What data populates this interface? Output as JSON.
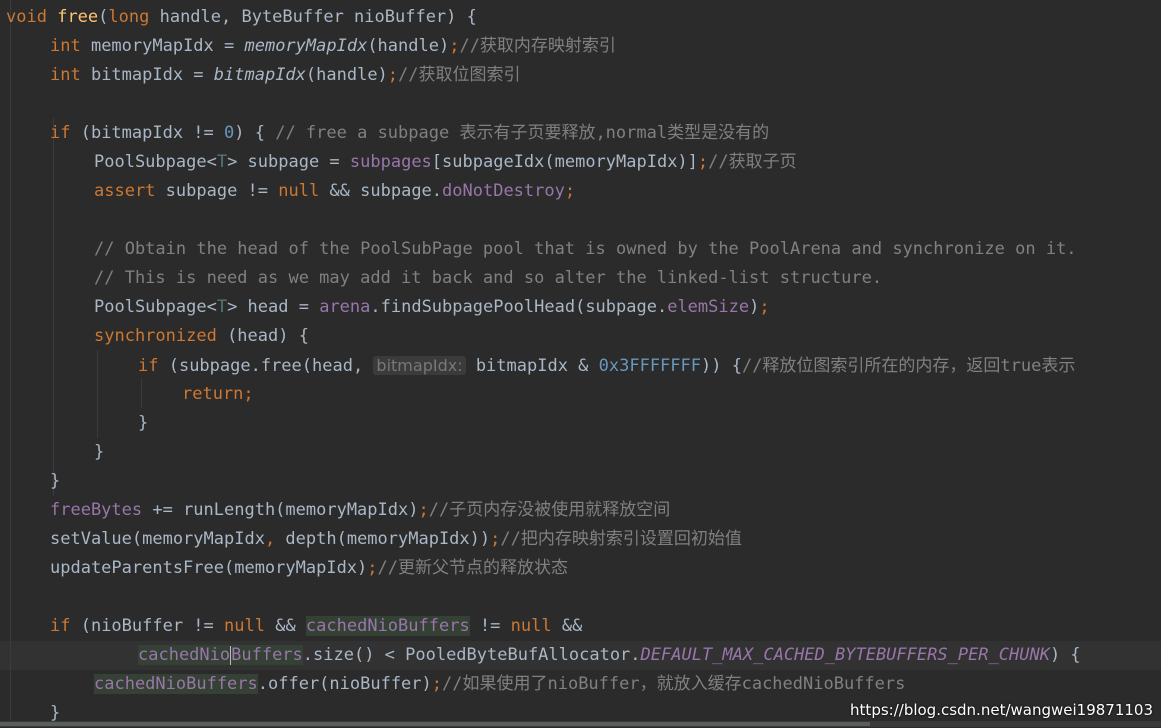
{
  "code": {
    "l1": {
      "void": "void",
      "space": " ",
      "name": "free",
      "p1": "(",
      "long": "long",
      "rest": " handle, ByteBuffer nioBuffer) {"
    },
    "l2": {
      "int": "int",
      "a": " memoryMapIdx = ",
      "m": "memoryMapIdx",
      "b": "(handle)",
      "semi": ";",
      "c": "//获取内存映射索引"
    },
    "l3": {
      "int": "int",
      "a": " bitmapIdx = ",
      "m": "bitmapIdx",
      "b": "(handle)",
      "semi": ";",
      "c": "//获取位图索引"
    },
    "l5": {
      "if": "if",
      "a": " (bitmapIdx != ",
      "n": "0",
      "b": ") { ",
      "c": "// free a subpage 表示有子页要释放,normal类型是没有的"
    },
    "l6": {
      "a": "PoolSubpage<",
      "t": "T",
      "b": "> subpage = ",
      "f": "subpages",
      "c": "[subpageIdx(memoryMapIdx)]",
      "semi": ";",
      "cm": "//获取子页"
    },
    "l7": {
      "assert": "assert",
      "a": " subpage != ",
      "null": "null",
      "b": " && subpage.",
      "f": "doNotDestroy",
      "semi": ";"
    },
    "l9": {
      "c": "// Obtain the head of the PoolSubPage pool that is owned by the PoolArena and synchronize on it."
    },
    "l10": {
      "c": "// This is need as we may add it back and so alter the linked-list structure."
    },
    "l11": {
      "a": "PoolSubpage<",
      "t": "T",
      "b": "> head = ",
      "f": "arena",
      "c": ".findSubpagePoolHead(subpage.",
      "f2": "elemSize",
      "d": ")",
      "semi": ";"
    },
    "l12": {
      "kw": "synchronized",
      "a": " (head) {"
    },
    "l13": {
      "if": "if",
      "a": " (subpage.free(head, ",
      "hint": "bitmapIdx:",
      "b": " bitmapIdx & ",
      "n": "0x3FFFFFFF",
      "c": ")) {",
      "cm": "//释放位图索引所在的内存，返回true表示"
    },
    "l14": {
      "kw": "return",
      "semi": ";"
    },
    "l15": {
      "a": "}"
    },
    "l16": {
      "a": "}"
    },
    "l17": {
      "a": "}"
    },
    "l18": {
      "f": "freeBytes",
      "a": " += runLength(memoryMapIdx)",
      "semi": ";",
      "c": "//子页内存没被使用就释放空间"
    },
    "l19": {
      "a": "setValue(memoryMapIdx",
      "comma": ",",
      "b": " depth(memoryMapIdx))",
      "semi": ";",
      "c": "//把内存映射索引设置回初始值"
    },
    "l20": {
      "a": "updateParentsFree(memoryMapIdx)",
      "semi": ";",
      "c": "//更新父节点的释放状态"
    },
    "l22": {
      "if": "if",
      "a": " (nioBuffer != ",
      "null": "null",
      "b": " && ",
      "f": "cachedNioBuffers",
      "c": " != ",
      "null2": "null",
      "d": " &&"
    },
    "l23": {
      "f1": "cachedNio",
      "f2": "Buffers",
      "a": ".size() < PooledByteBufAllocator.",
      "s": "DEFAULT_MAX_CACHED_BYTEBUFFERS_PER_CHUNK",
      "b": ") {"
    },
    "l24": {
      "f": "cachedNioBuffers",
      "a": ".offer(nioBuffer)",
      "semi": ";",
      "c": "//如果使用了nioBuffer，就放入缓存cachedNioBuffers"
    },
    "l25": {
      "a": "}"
    }
  },
  "watermark": "https://blog.csdn.net/wangwei19871103",
  "colors": {
    "background": "#2b2b2b",
    "keyword": "#cc7832",
    "field": "#9876aa",
    "method": "#ffc66d",
    "number": "#6897bb",
    "comment": "#808080",
    "text": "#a9b7c6"
  }
}
